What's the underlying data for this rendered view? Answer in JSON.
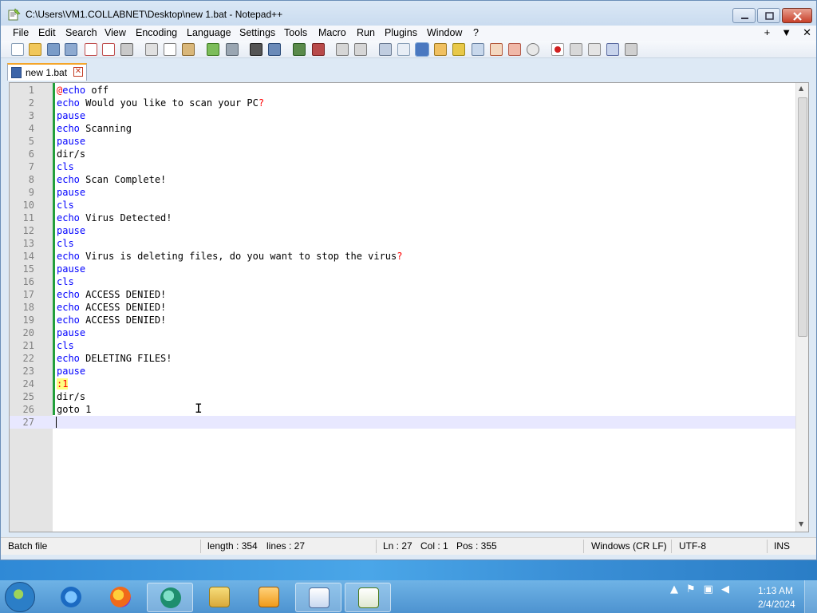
{
  "window": {
    "title": "C:\\Users\\VM1.COLLABNET\\Desktop\\new 1.bat - Notepad++"
  },
  "menu": {
    "items": [
      "File",
      "Edit",
      "Search",
      "View",
      "Encoding",
      "Language",
      "Settings",
      "Tools",
      "Macro",
      "Run",
      "Plugins",
      "Window",
      "?"
    ],
    "right": [
      "+",
      "▼",
      "✕"
    ]
  },
  "tab": {
    "label": "new 1.bat",
    "close": "✕"
  },
  "editor": {
    "lines": [
      {
        "n": "1",
        "parts": [
          {
            "t": "@",
            "c": "red"
          },
          {
            "t": "echo",
            "c": "kw"
          },
          {
            "t": " off",
            "c": ""
          }
        ]
      },
      {
        "n": "2",
        "parts": [
          {
            "t": "echo",
            "c": "kw"
          },
          {
            "t": " Would you like to scan your PC",
            "c": ""
          },
          {
            "t": "?",
            "c": "red"
          }
        ]
      },
      {
        "n": "3",
        "parts": [
          {
            "t": "pause",
            "c": "kw"
          }
        ]
      },
      {
        "n": "4",
        "parts": [
          {
            "t": "echo",
            "c": "kw"
          },
          {
            "t": " Scanning",
            "c": ""
          }
        ]
      },
      {
        "n": "5",
        "parts": [
          {
            "t": "pause",
            "c": "kw"
          }
        ]
      },
      {
        "n": "6",
        "parts": [
          {
            "t": "dir/s",
            "c": ""
          }
        ]
      },
      {
        "n": "7",
        "parts": [
          {
            "t": "cls",
            "c": "kw"
          }
        ]
      },
      {
        "n": "8",
        "parts": [
          {
            "t": "echo",
            "c": "kw"
          },
          {
            "t": " Scan Complete!",
            "c": ""
          }
        ]
      },
      {
        "n": "9",
        "parts": [
          {
            "t": "pause",
            "c": "kw"
          }
        ]
      },
      {
        "n": "10",
        "parts": [
          {
            "t": "cls",
            "c": "kw"
          }
        ]
      },
      {
        "n": "11",
        "parts": [
          {
            "t": "echo",
            "c": "kw"
          },
          {
            "t": " Virus Detected!",
            "c": ""
          }
        ]
      },
      {
        "n": "12",
        "parts": [
          {
            "t": "pause",
            "c": "kw"
          }
        ]
      },
      {
        "n": "13",
        "parts": [
          {
            "t": "cls",
            "c": "kw"
          }
        ]
      },
      {
        "n": "14",
        "parts": [
          {
            "t": "echo",
            "c": "kw"
          },
          {
            "t": " Virus is deleting files, do you want to stop the virus",
            "c": ""
          },
          {
            "t": "?",
            "c": "red"
          }
        ]
      },
      {
        "n": "15",
        "parts": [
          {
            "t": "pause",
            "c": "kw"
          }
        ]
      },
      {
        "n": "16",
        "parts": [
          {
            "t": "cls",
            "c": "kw"
          }
        ]
      },
      {
        "n": "17",
        "parts": [
          {
            "t": "echo",
            "c": "kw"
          },
          {
            "t": " ACCESS DENIED!",
            "c": ""
          }
        ]
      },
      {
        "n": "18",
        "parts": [
          {
            "t": "echo",
            "c": "kw"
          },
          {
            "t": " ACCESS DENIED!",
            "c": ""
          }
        ]
      },
      {
        "n": "19",
        "parts": [
          {
            "t": "echo",
            "c": "kw"
          },
          {
            "t": " ACCESS DENIED!",
            "c": ""
          }
        ]
      },
      {
        "n": "20",
        "parts": [
          {
            "t": "pause",
            "c": "kw"
          }
        ]
      },
      {
        "n": "21",
        "parts": [
          {
            "t": "cls",
            "c": "kw"
          }
        ]
      },
      {
        "n": "22",
        "parts": [
          {
            "t": "echo",
            "c": "kw"
          },
          {
            "t": " DELETING FILES!",
            "c": ""
          }
        ]
      },
      {
        "n": "23",
        "parts": [
          {
            "t": "pause",
            "c": "kw"
          }
        ]
      },
      {
        "n": "24",
        "parts": [
          {
            "t": ":1",
            "c": "label"
          }
        ]
      },
      {
        "n": "25",
        "parts": [
          {
            "t": "dir/s",
            "c": ""
          }
        ]
      },
      {
        "n": "26",
        "parts": [
          {
            "t": "goto",
            "c": ""
          },
          {
            "t": " 1",
            "c": ""
          }
        ]
      },
      {
        "n": "27",
        "parts": []
      }
    ],
    "current_line": 27
  },
  "status": {
    "type": "Batch file",
    "length": "length : 354",
    "lines": "lines : 27",
    "ln": "Ln : 27",
    "col": "Col : 1",
    "pos": "Pos : 355",
    "eol": "Windows (CR LF)",
    "encoding": "UTF-8",
    "mode": "INS"
  },
  "taskbar": {
    "time": "1:13 AM",
    "date": "2/4/2024",
    "apps": [
      "internet-explorer",
      "firefox",
      "edge-beta",
      "file-explorer",
      "media-player",
      "wordpad",
      "notepad-plus-plus"
    ],
    "tray_icons": [
      "show-hidden-icons",
      "action-center-flag",
      "network",
      "volume-muted"
    ]
  },
  "colors": {
    "keyword": "#0000ff",
    "operator": "#ff0000",
    "label_bg": "#ffff80",
    "current_line_bg": "#e8e8ff",
    "change_bar": "#23a03c"
  }
}
